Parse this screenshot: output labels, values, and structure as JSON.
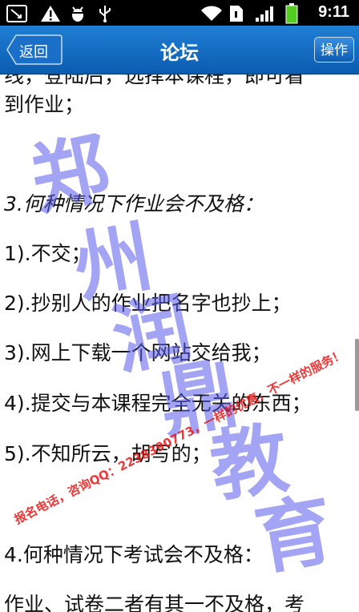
{
  "status_bar": {
    "time": "9:11",
    "icons": [
      "missed-call-icon",
      "warning-icon",
      "android-debug-icon",
      "usb-icon",
      "wifi-icon",
      "sim-icon",
      "signal-icon",
      "battery-icon"
    ]
  },
  "header": {
    "back_label": "返回",
    "title": "论坛",
    "action_label": "操作"
  },
  "content": {
    "lines": [
      "线，登陆后，选择本课程，即可看",
      "到作业；",
      "3.何种情况下作业会不及格：",
      "1).不交；",
      "2).抄别人的作业把名字也抄上；",
      "3).网上下载一个网站交给我；",
      "4).提交与本课程完全无关的东西；",
      "5).不知所云，胡写的；",
      "4.何种情况下考试会不及格：",
      "作业、试卷二者有其一不及格，考"
    ]
  },
  "watermark": {
    "chars": [
      "郑",
      "州",
      "润",
      "鼎",
      "教",
      "育"
    ],
    "slogan": "报名电话，咨询QQ：2238390773，一样的优惠，不一样的服务！"
  },
  "colors": {
    "header_bg": "#1566c2",
    "watermark_blue": "#5a5aeb",
    "watermark_red": "#eb1414"
  }
}
